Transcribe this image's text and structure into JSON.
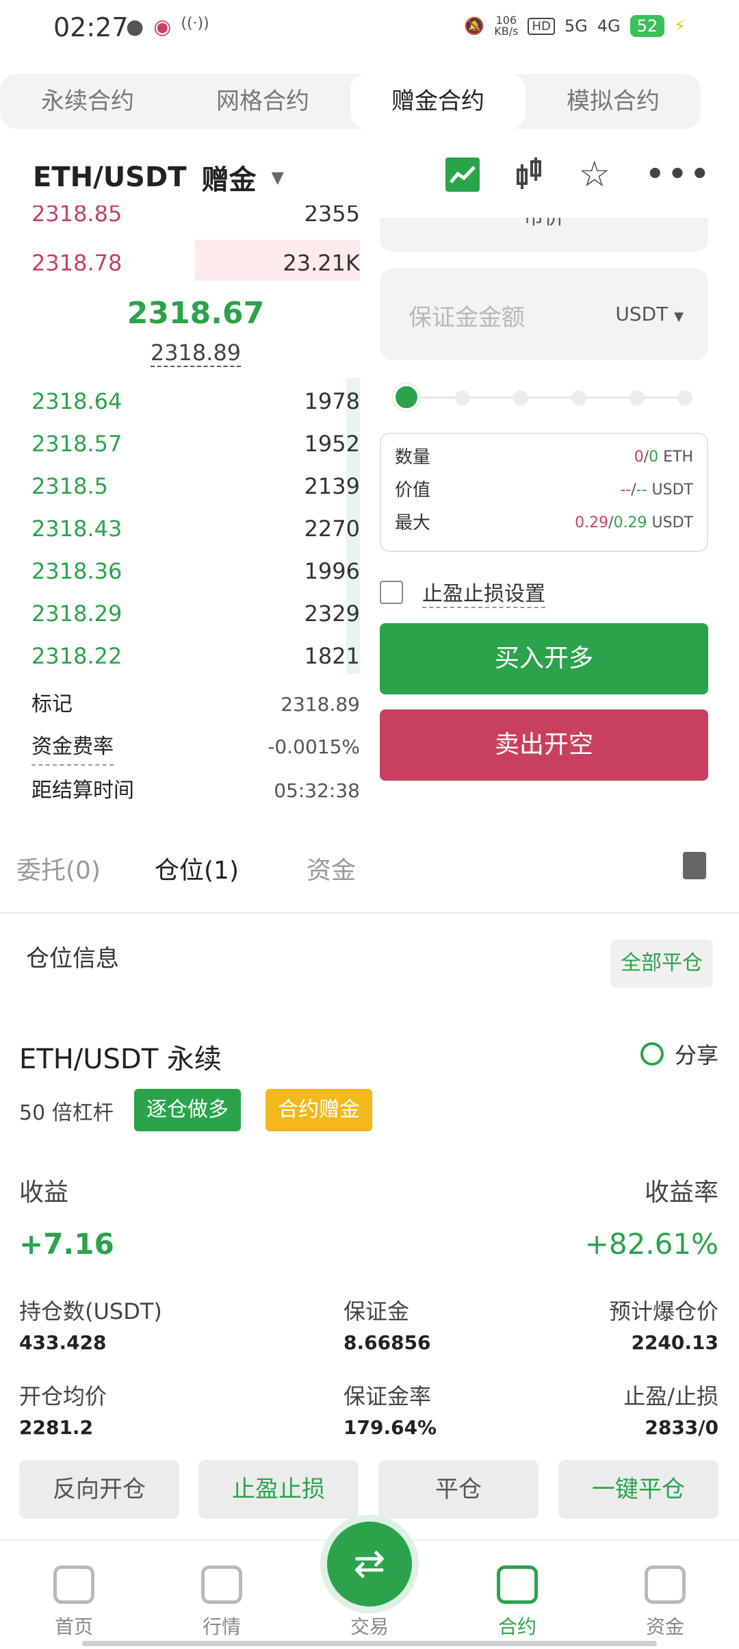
{
  "status_bar": {
    "time": "02:27",
    "speed": "106",
    "speed_unit": "KB/s",
    "net1": "5G",
    "net2": "4G",
    "battery": "52"
  },
  "top_tabs": [
    "永续合约",
    "网格合约",
    "赠金合约",
    "模拟合约"
  ],
  "pair": {
    "symbol": "ETH/USDT",
    "mode": "赠金"
  },
  "order_book": {
    "asks": [
      {
        "price": "2318.85",
        "qty": "2355"
      },
      {
        "price": "2318.78",
        "qty": "23.21K"
      }
    ],
    "last_price": "2318.67",
    "mark_price": "2318.89",
    "bids": [
      {
        "price": "2318.64",
        "qty": "1978"
      },
      {
        "price": "2318.57",
        "qty": "1952"
      },
      {
        "price": "2318.5",
        "qty": "2139"
      },
      {
        "price": "2318.43",
        "qty": "2270"
      },
      {
        "price": "2318.36",
        "qty": "1996"
      },
      {
        "price": "2318.29",
        "qty": "2329"
      },
      {
        "price": "2318.22",
        "qty": "1821"
      }
    ],
    "info": [
      {
        "label": "标记",
        "value": "2318.89"
      },
      {
        "label": "资金费率",
        "value": "-0.0015%"
      },
      {
        "label": "距结算时间",
        "value": "05:32:38"
      }
    ]
  },
  "order_form": {
    "price_type": "市价",
    "margin_placeholder": "保证金金额",
    "margin_unit": "USDT",
    "slider_percent": 0,
    "summary": {
      "qty_label": "数量",
      "qty_a": "0",
      "qty_sep": "/",
      "qty_b": "0",
      "qty_unit": "ETH",
      "value_label": "价值",
      "value_a": "--",
      "value_sep": "/",
      "value_b": "--",
      "value_unit": "USDT",
      "max_label": "最大",
      "max_a": "0.29",
      "max_sep": "/",
      "max_b": "0.29",
      "max_unit": "USDT"
    },
    "tpsl_label": "止盈止损设置",
    "buy_label": "买入开多",
    "sell_label": "卖出开空"
  },
  "sub_tabs": {
    "orders": "委托(0)",
    "positions": "仓位(1)",
    "funds": "资金"
  },
  "position": {
    "section_title": "仓位信息",
    "close_all": "全部平仓",
    "name": "ETH/USDT 永续",
    "share": "分享",
    "leverage": "50 倍杠杆",
    "tag_side": "逐仓做多",
    "tag_bonus": "合约赠金",
    "pnl_label": "收益",
    "pnl_value": "+7.16",
    "roe_label": "收益率",
    "roe_value": "+82.61%",
    "size_label": "持仓数(USDT)",
    "size_value": "433.428",
    "margin_label": "保证金",
    "margin_value": "8.66856",
    "liq_label": "预计爆仓价",
    "liq_value": "2240.13",
    "entry_label": "开仓均价",
    "entry_value": "2281.2",
    "margin_ratio_label": "保证金率",
    "margin_ratio_value": "179.64%",
    "tpsl_label": "止盈/止损",
    "tpsl_value": "2833/0"
  },
  "actions": [
    "反向开仓",
    "止盈止损",
    "平仓",
    "一键平仓"
  ],
  "bottom_nav": [
    "首页",
    "行情",
    "交易",
    "合约",
    "资金"
  ],
  "colors": {
    "accent": "#2aa34a",
    "sell": "#c9405f",
    "bonus": "#f2b81d"
  }
}
